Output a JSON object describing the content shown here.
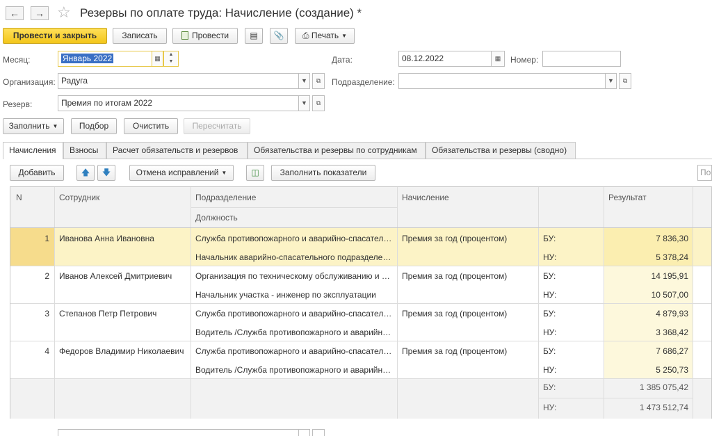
{
  "window": {
    "title": "Резервы по оплате труда: Начисление (создание) *"
  },
  "toolbar": {
    "post_close": "Провести и закрыть",
    "save": "Записать",
    "post": "Провести",
    "print": "Печать"
  },
  "form": {
    "month_label": "Месяц:",
    "month_value": "Январь 2022",
    "date_label": "Дата:",
    "date_value": "08.12.2022",
    "number_label": "Номер:",
    "number_value": "",
    "org_label": "Организация:",
    "org_value": "Радуга",
    "dept_label": "Подразделение:",
    "dept_value": "",
    "reserve_label": "Резерв:",
    "reserve_value": "Премия по итогам 2022"
  },
  "actions": {
    "fill": "Заполнить",
    "pick": "Подбор",
    "clear": "Очистить",
    "recalc": "Пересчитать"
  },
  "tabs": [
    {
      "label": "Начисления"
    },
    {
      "label": "Взносы"
    },
    {
      "label": "Расчет обязательств и резервов"
    },
    {
      "label": "Обязательства и резервы по сотрудникам"
    },
    {
      "label": "Обязательства и резервы (сводно)"
    }
  ],
  "table_toolbar": {
    "add": "Добавить",
    "cancel_corrections": "Отмена исправлений",
    "fill_indicators": "Заполнить показатели",
    "search_placeholder": "По"
  },
  "table": {
    "headers": {
      "n": "N",
      "employee": "Сотрудник",
      "department": "Подразделение",
      "position": "Должность",
      "accrual": "Начисление",
      "result": "Результат"
    },
    "rows": [
      {
        "n": "1",
        "employee": "Иванова Анна Ивановна",
        "department": "Служба противопожарного и аварийно-спасательного",
        "position": "Начальник аварийно-спасательного подразделения",
        "accrual": "Премия за год (процентом)",
        "bu_label": "БУ:",
        "bu": "7 836,30",
        "nu_label": "НУ:",
        "nu": "5 378,24"
      },
      {
        "n": "2",
        "employee": "Иванов Алексей Дмитриевич",
        "department": "Организация по техническому обслуживанию и ремонту",
        "position": "Начальник участка -  инженер по эксплуатации",
        "accrual": "Премия за год (процентом)",
        "bu_label": "БУ:",
        "bu": "14 195,91",
        "nu_label": "НУ:",
        "nu": "10 507,00"
      },
      {
        "n": "3",
        "employee": "Степанов Петр Петрович",
        "department": "Служба противопожарного и аварийно-спасательного",
        "position": "Водитель /Служба противопожарного и аварийно-спасательного",
        "accrual": "Премия за год (процентом)",
        "bu_label": "БУ:",
        "bu": "4 879,93",
        "nu_label": "НУ:",
        "nu": "3 368,42"
      },
      {
        "n": "4",
        "employee": "Федоров Владимир Николаевич",
        "department": "Служба противопожарного и аварийно-спасательного",
        "position": "Водитель /Служба противопожарного и аварийно-спасательного",
        "accrual": "Премия за год (процентом)",
        "bu_label": "БУ:",
        "bu": "7 686,27",
        "nu_label": "НУ:",
        "nu": "5 250,73"
      }
    ],
    "totals": {
      "bu_label": "БУ:",
      "bu": "1 385 075,42",
      "nu_label": "НУ:",
      "nu": "1 473 512,74"
    }
  },
  "colors": {
    "primary_button": "#f3c61a",
    "selected_row": "#fcf3c6",
    "result_highlight": "#fbeeb0"
  }
}
